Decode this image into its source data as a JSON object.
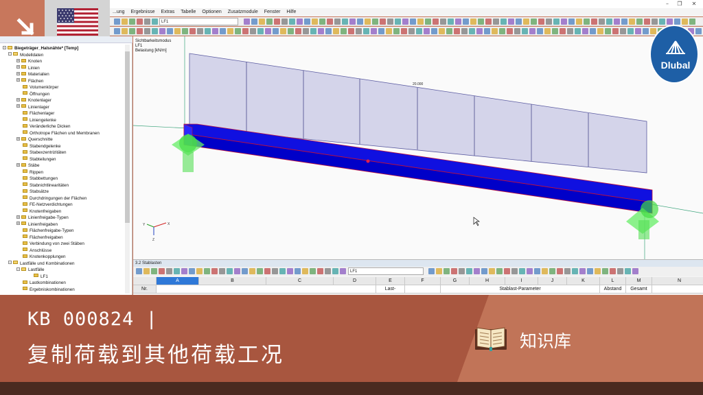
{
  "window": {
    "minimize_glyph": "–",
    "restore_glyph": "❐",
    "close_glyph": "✕"
  },
  "menu": {
    "items": [
      "...ung",
      "Ergebnisse",
      "Extras",
      "Tabelle",
      "Optionen",
      "Zusatzmodule",
      "Fenster",
      "Hilfe"
    ]
  },
  "toolbar": {
    "loadcase_combo": "LF1"
  },
  "navigator": {
    "root": "Biegeträger_Halsnähte* [Temp]",
    "items": [
      {
        "label": "Modelldaten",
        "level": 1,
        "expand": "-"
      },
      {
        "label": "Knoten",
        "level": 2,
        "expand": "+"
      },
      {
        "label": "Linien",
        "level": 2,
        "expand": "+"
      },
      {
        "label": "Materialien",
        "level": 2,
        "expand": "+"
      },
      {
        "label": "Flächen",
        "level": 2,
        "expand": "+"
      },
      {
        "label": "Volumenkörper",
        "level": 2,
        "expand": ""
      },
      {
        "label": "Öffnungen",
        "level": 2,
        "expand": ""
      },
      {
        "label": "Knotenlager",
        "level": 2,
        "expand": "+"
      },
      {
        "label": "Linienlager",
        "level": 2,
        "expand": "+"
      },
      {
        "label": "Flächenlager",
        "level": 2,
        "expand": ""
      },
      {
        "label": "Liniengelenke",
        "level": 2,
        "expand": ""
      },
      {
        "label": "Veränderliche Dicken",
        "level": 2,
        "expand": ""
      },
      {
        "label": "Orthotrope Flächen und Membranen",
        "level": 2,
        "expand": ""
      },
      {
        "label": "Querschnitte",
        "level": 2,
        "expand": "+"
      },
      {
        "label": "Stabendgelenke",
        "level": 2,
        "expand": ""
      },
      {
        "label": "Stabexzentrizitäten",
        "level": 2,
        "expand": ""
      },
      {
        "label": "Stabteilungen",
        "level": 2,
        "expand": ""
      },
      {
        "label": "Stäbe",
        "level": 2,
        "expand": "+"
      },
      {
        "label": "Rippen",
        "level": 2,
        "expand": ""
      },
      {
        "label": "Stabbettungen",
        "level": 2,
        "expand": ""
      },
      {
        "label": "Stabnichtlinearitäten",
        "level": 2,
        "expand": ""
      },
      {
        "label": "Stabsätze",
        "level": 2,
        "expand": ""
      },
      {
        "label": "Durchdringungen der Flächen",
        "level": 2,
        "expand": ""
      },
      {
        "label": "FE-Netzverdichtungen",
        "level": 2,
        "expand": ""
      },
      {
        "label": "Knotenfreigaben",
        "level": 2,
        "expand": ""
      },
      {
        "label": "Linienfreigabe-Typen",
        "level": 2,
        "expand": "+"
      },
      {
        "label": "Linienfreigaben",
        "level": 2,
        "expand": "+"
      },
      {
        "label": "Flächenfreigabe-Typen",
        "level": 2,
        "expand": ""
      },
      {
        "label": "Flächenfreigaben",
        "level": 2,
        "expand": ""
      },
      {
        "label": "Verbindung von zwei Stäben",
        "level": 2,
        "expand": ""
      },
      {
        "label": "Anschlüsse",
        "level": 2,
        "expand": ""
      },
      {
        "label": "Knotenkopplungen",
        "level": 2,
        "expand": ""
      },
      {
        "label": "Lastfälle und Kombinationen",
        "level": 1,
        "expand": "-"
      },
      {
        "label": "Lastfälle",
        "level": 2,
        "expand": "-"
      },
      {
        "label": "LF1",
        "level": 3,
        "expand": ""
      },
      {
        "label": "Lastkombinationen",
        "level": 2,
        "expand": ""
      },
      {
        "label": "Ergebniskombinationen",
        "level": 2,
        "expand": ""
      }
    ]
  },
  "viewport": {
    "info_lines": [
      "Sichtbarkeitsmodus",
      "LF1",
      "Belastung [kN/m]"
    ],
    "load_value_label": "20.000",
    "axis_x": "X",
    "axis_y": "Y",
    "axis_z": "Z",
    "colors": {
      "beam": "#1010e0",
      "load_fill": "#d4d4ea",
      "support": "#44dd44"
    }
  },
  "table_panel": {
    "title": "3.2 Stablasten",
    "loadcase_combo": "LF1",
    "columns": [
      "A",
      "B",
      "C",
      "D",
      "E",
      "F",
      "G",
      "H",
      "I",
      "J",
      "K",
      "L",
      "M",
      "N"
    ],
    "subheader": {
      "E": "Last-",
      "H": "Stablast-Parameter",
      "L": "Abstand",
      "M": "Gesamt"
    },
    "row_label": "Nr."
  },
  "overlay": {
    "kb_code": "KB 000824 |",
    "kb_title": "复制荷载到其他荷载工况",
    "category_label": "知识库",
    "brand": "Dlubal",
    "colors": {
      "band": "#a8563f",
      "band_right": "#c17458",
      "corner": "#c8775c"
    }
  }
}
